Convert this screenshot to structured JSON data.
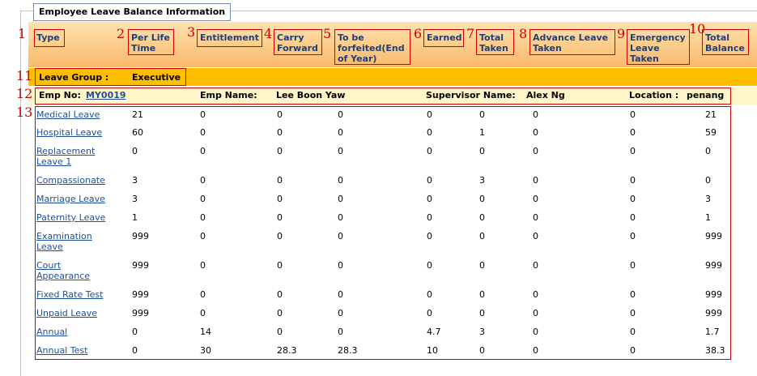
{
  "legend": "Employee Leave Balance Information",
  "markers": [
    "1",
    "2",
    "3",
    "4",
    "5",
    "6",
    "7",
    "8",
    "9",
    "10",
    "11",
    "12",
    "13"
  ],
  "headers": [
    {
      "key": "type",
      "lines": [
        "Type"
      ]
    },
    {
      "key": "per_life_time",
      "lines": [
        "Per Life",
        "Time"
      ]
    },
    {
      "key": "entitlement",
      "lines": [
        "Entitlement"
      ]
    },
    {
      "key": "carry_forward",
      "lines": [
        "Carry",
        "Forward"
      ]
    },
    {
      "key": "to_be_forfeited",
      "lines": [
        "To be",
        "forfeited(End",
        "of Year)"
      ]
    },
    {
      "key": "earned",
      "lines": [
        "Earned"
      ]
    },
    {
      "key": "total_taken",
      "lines": [
        "Total",
        "Taken"
      ]
    },
    {
      "key": "advance_leave_taken",
      "lines": [
        "Advance Leave",
        "Taken"
      ]
    },
    {
      "key": "emergency_leave_taken",
      "lines": [
        "Emergency",
        "Leave",
        "Taken"
      ]
    },
    {
      "key": "total_balance",
      "lines": [
        "Total",
        "Balance"
      ]
    }
  ],
  "group": {
    "label": "Leave Group :",
    "value": "Executive"
  },
  "employee": {
    "emp_no_label": "Emp No:",
    "emp_no": "MY0019",
    "name_label": "Emp Name:",
    "name": "Lee Boon Yaw",
    "supervisor_label": "Supervisor Name:",
    "supervisor": "Alex Ng",
    "location_label": "Location :",
    "location": "penang"
  },
  "rows": [
    {
      "type": "Medical Leave",
      "values": [
        "21",
        "0",
        "0",
        "0",
        "0",
        "0",
        "0",
        "0",
        "21"
      ]
    },
    {
      "type": "Hospital Leave",
      "values": [
        "60",
        "0",
        "0",
        "0",
        "0",
        "1",
        "0",
        "0",
        "59"
      ]
    },
    {
      "type": "Replacement Leave 1",
      "values": [
        "0",
        "0",
        "0",
        "0",
        "0",
        "0",
        "0",
        "0",
        "0"
      ]
    },
    {
      "type": "Compassionate",
      "values": [
        "3",
        "0",
        "0",
        "0",
        "0",
        "3",
        "0",
        "0",
        "0"
      ]
    },
    {
      "type": "Marriage Leave",
      "values": [
        "3",
        "0",
        "0",
        "0",
        "0",
        "0",
        "0",
        "0",
        "3"
      ]
    },
    {
      "type": "Paternity Leave",
      "values": [
        "1",
        "0",
        "0",
        "0",
        "0",
        "0",
        "0",
        "0",
        "1"
      ]
    },
    {
      "type": "Examination Leave",
      "values": [
        "999",
        "0",
        "0",
        "0",
        "0",
        "0",
        "0",
        "0",
        "999"
      ]
    },
    {
      "type": "Court Appearance",
      "values": [
        "999",
        "0",
        "0",
        "0",
        "0",
        "0",
        "0",
        "0",
        "999"
      ]
    },
    {
      "type": "Fixed Rate Test",
      "values": [
        "999",
        "0",
        "0",
        "0",
        "0",
        "0",
        "0",
        "0",
        "999"
      ]
    },
    {
      "type": "Unpaid Leave",
      "values": [
        "999",
        "0",
        "0",
        "0",
        "0",
        "0",
        "0",
        "0",
        "999"
      ]
    },
    {
      "type": "Annual",
      "values": [
        "0",
        "14",
        "0",
        "0",
        "4.7",
        "3",
        "0",
        "0",
        "1.7"
      ]
    },
    {
      "type": "Annual Test",
      "values": [
        "0",
        "30",
        "28.3",
        "28.3",
        "10",
        "0",
        "0",
        "0",
        "38.3"
      ]
    }
  ],
  "colors": {
    "annotation": "#d00000",
    "header_gradient": [
      "#ffe2b0",
      "#f9b96a"
    ],
    "group_bar": "#ffbf00",
    "emp_bar": "#fff7c9",
    "link": "#1f4f9a"
  }
}
